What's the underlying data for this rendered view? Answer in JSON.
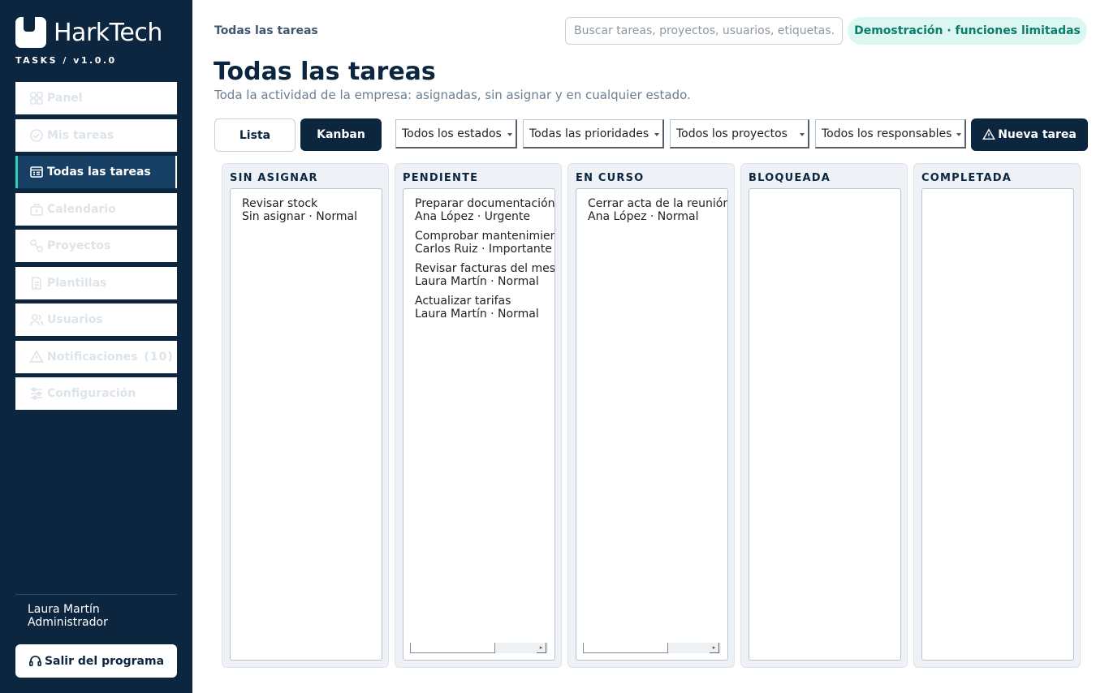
{
  "app": {
    "name": "HarkTech",
    "version_label": "TASKS / v1.0.0"
  },
  "sidebar": {
    "items": [
      {
        "label": "Panel",
        "icon": "grid-icon"
      },
      {
        "label": "Mis tareas",
        "icon": "check-circle-icon"
      },
      {
        "label": "Todas las tareas",
        "icon": "task-list-icon",
        "active": true
      },
      {
        "label": "Calendario",
        "icon": "calendar-icon"
      },
      {
        "label": "Proyectos",
        "icon": "projects-icon"
      },
      {
        "label": "Plantillas",
        "icon": "document-icon"
      },
      {
        "label": "Usuarios",
        "icon": "users-icon"
      },
      {
        "label": "Notificaciones",
        "icon": "warning-icon",
        "count": "(10)"
      },
      {
        "label": "Configuración",
        "icon": "sliders-icon"
      }
    ],
    "user": {
      "name": "Laura Martín",
      "role": "Administrador"
    },
    "logout_label": "Salir del programa"
  },
  "header": {
    "breadcrumb": "Todas las tareas",
    "search_placeholder": "Buscar tareas, proyectos, usuarios, etiquetas...",
    "demo_badge": "Demostración · funciones limitadas"
  },
  "main": {
    "title": "Todas las tareas",
    "subtitle": "Toda la actividad de la empresa: asignadas, sin asignar y en cualquier estado.",
    "view_toggle": {
      "list_label": "Lista",
      "kanban_label": "Kanban",
      "selected": "Kanban"
    },
    "filters": {
      "status": "Todos los estados",
      "priority": "Todas las prioridades",
      "project": "Todos los proyectos",
      "assignee": "Todos los responsables"
    },
    "new_task_label": "Nueva tarea"
  },
  "kanban": {
    "columns": [
      {
        "title": "SIN ASIGNAR",
        "tasks": [
          {
            "title": "Revisar stock",
            "meta": "Sin asignar · Normal"
          }
        ]
      },
      {
        "title": "PENDIENTE",
        "tasks": [
          {
            "title": "Preparar documentación",
            "meta": "Ana López · Urgente"
          },
          {
            "title": "Comprobar mantenimien",
            "meta": "Carlos Ruiz · Importante"
          },
          {
            "title": "Revisar facturas del mes",
            "meta": "Laura Martín · Normal"
          },
          {
            "title": "Actualizar tarifas",
            "meta": "Laura Martín · Normal"
          }
        ]
      },
      {
        "title": "EN CURSO",
        "tasks": [
          {
            "title": "Cerrar acta de la reunión",
            "meta": "Ana López · Normal"
          }
        ]
      },
      {
        "title": "BLOQUEADA",
        "tasks": []
      },
      {
        "title": "COMPLETADA",
        "tasks": []
      }
    ]
  },
  "colors": {
    "sidebar_bg": "#0d2640",
    "accent": "#2fd0b9",
    "badge_bg": "#dcf7f1",
    "badge_text": "#0b7d6a"
  }
}
